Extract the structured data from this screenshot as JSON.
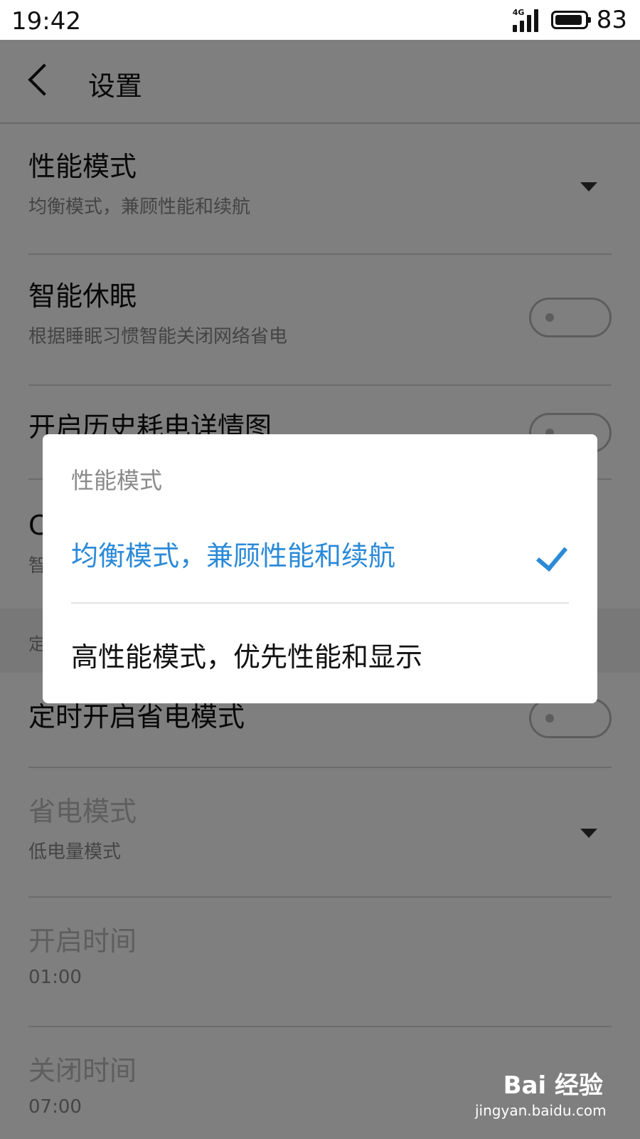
{
  "status_bar": {
    "time": "19:42",
    "network": "4G",
    "battery": "83"
  },
  "header": {
    "title": "设置"
  },
  "settings": {
    "performance": {
      "title": "性能模式",
      "subtitle": "均衡模式，兼顾性能和续航"
    },
    "smart_sleep": {
      "title": "智能休眠",
      "subtitle": "根据睡眠习惯智能关闭网络省电"
    },
    "history": {
      "title": "开启历史耗电详情图"
    },
    "hidden_row": {
      "title_fragment": "C",
      "subtitle_fragment": "智"
    },
    "section_fragment": "定",
    "scheduled_power_saving": {
      "title": "定时开启省电模式"
    },
    "power_saving_mode": {
      "title": "省电模式",
      "subtitle": "低电量模式"
    },
    "start_time": {
      "title": "开启时间",
      "value": "01:00"
    },
    "end_time": {
      "title": "关闭时间",
      "value": "07:00"
    }
  },
  "dialog": {
    "title": "性能模式",
    "options": [
      {
        "label": "均衡模式，兼顾性能和续航",
        "selected": true
      },
      {
        "label": "高性能模式，优先性能和显示",
        "selected": false
      }
    ]
  },
  "watermark": {
    "logo": "Bai 经验",
    "url": "jingyan.baidu.com"
  },
  "colors": {
    "accent": "#2b8ad8",
    "overlay": "rgba(0,0,0,0.5)"
  }
}
